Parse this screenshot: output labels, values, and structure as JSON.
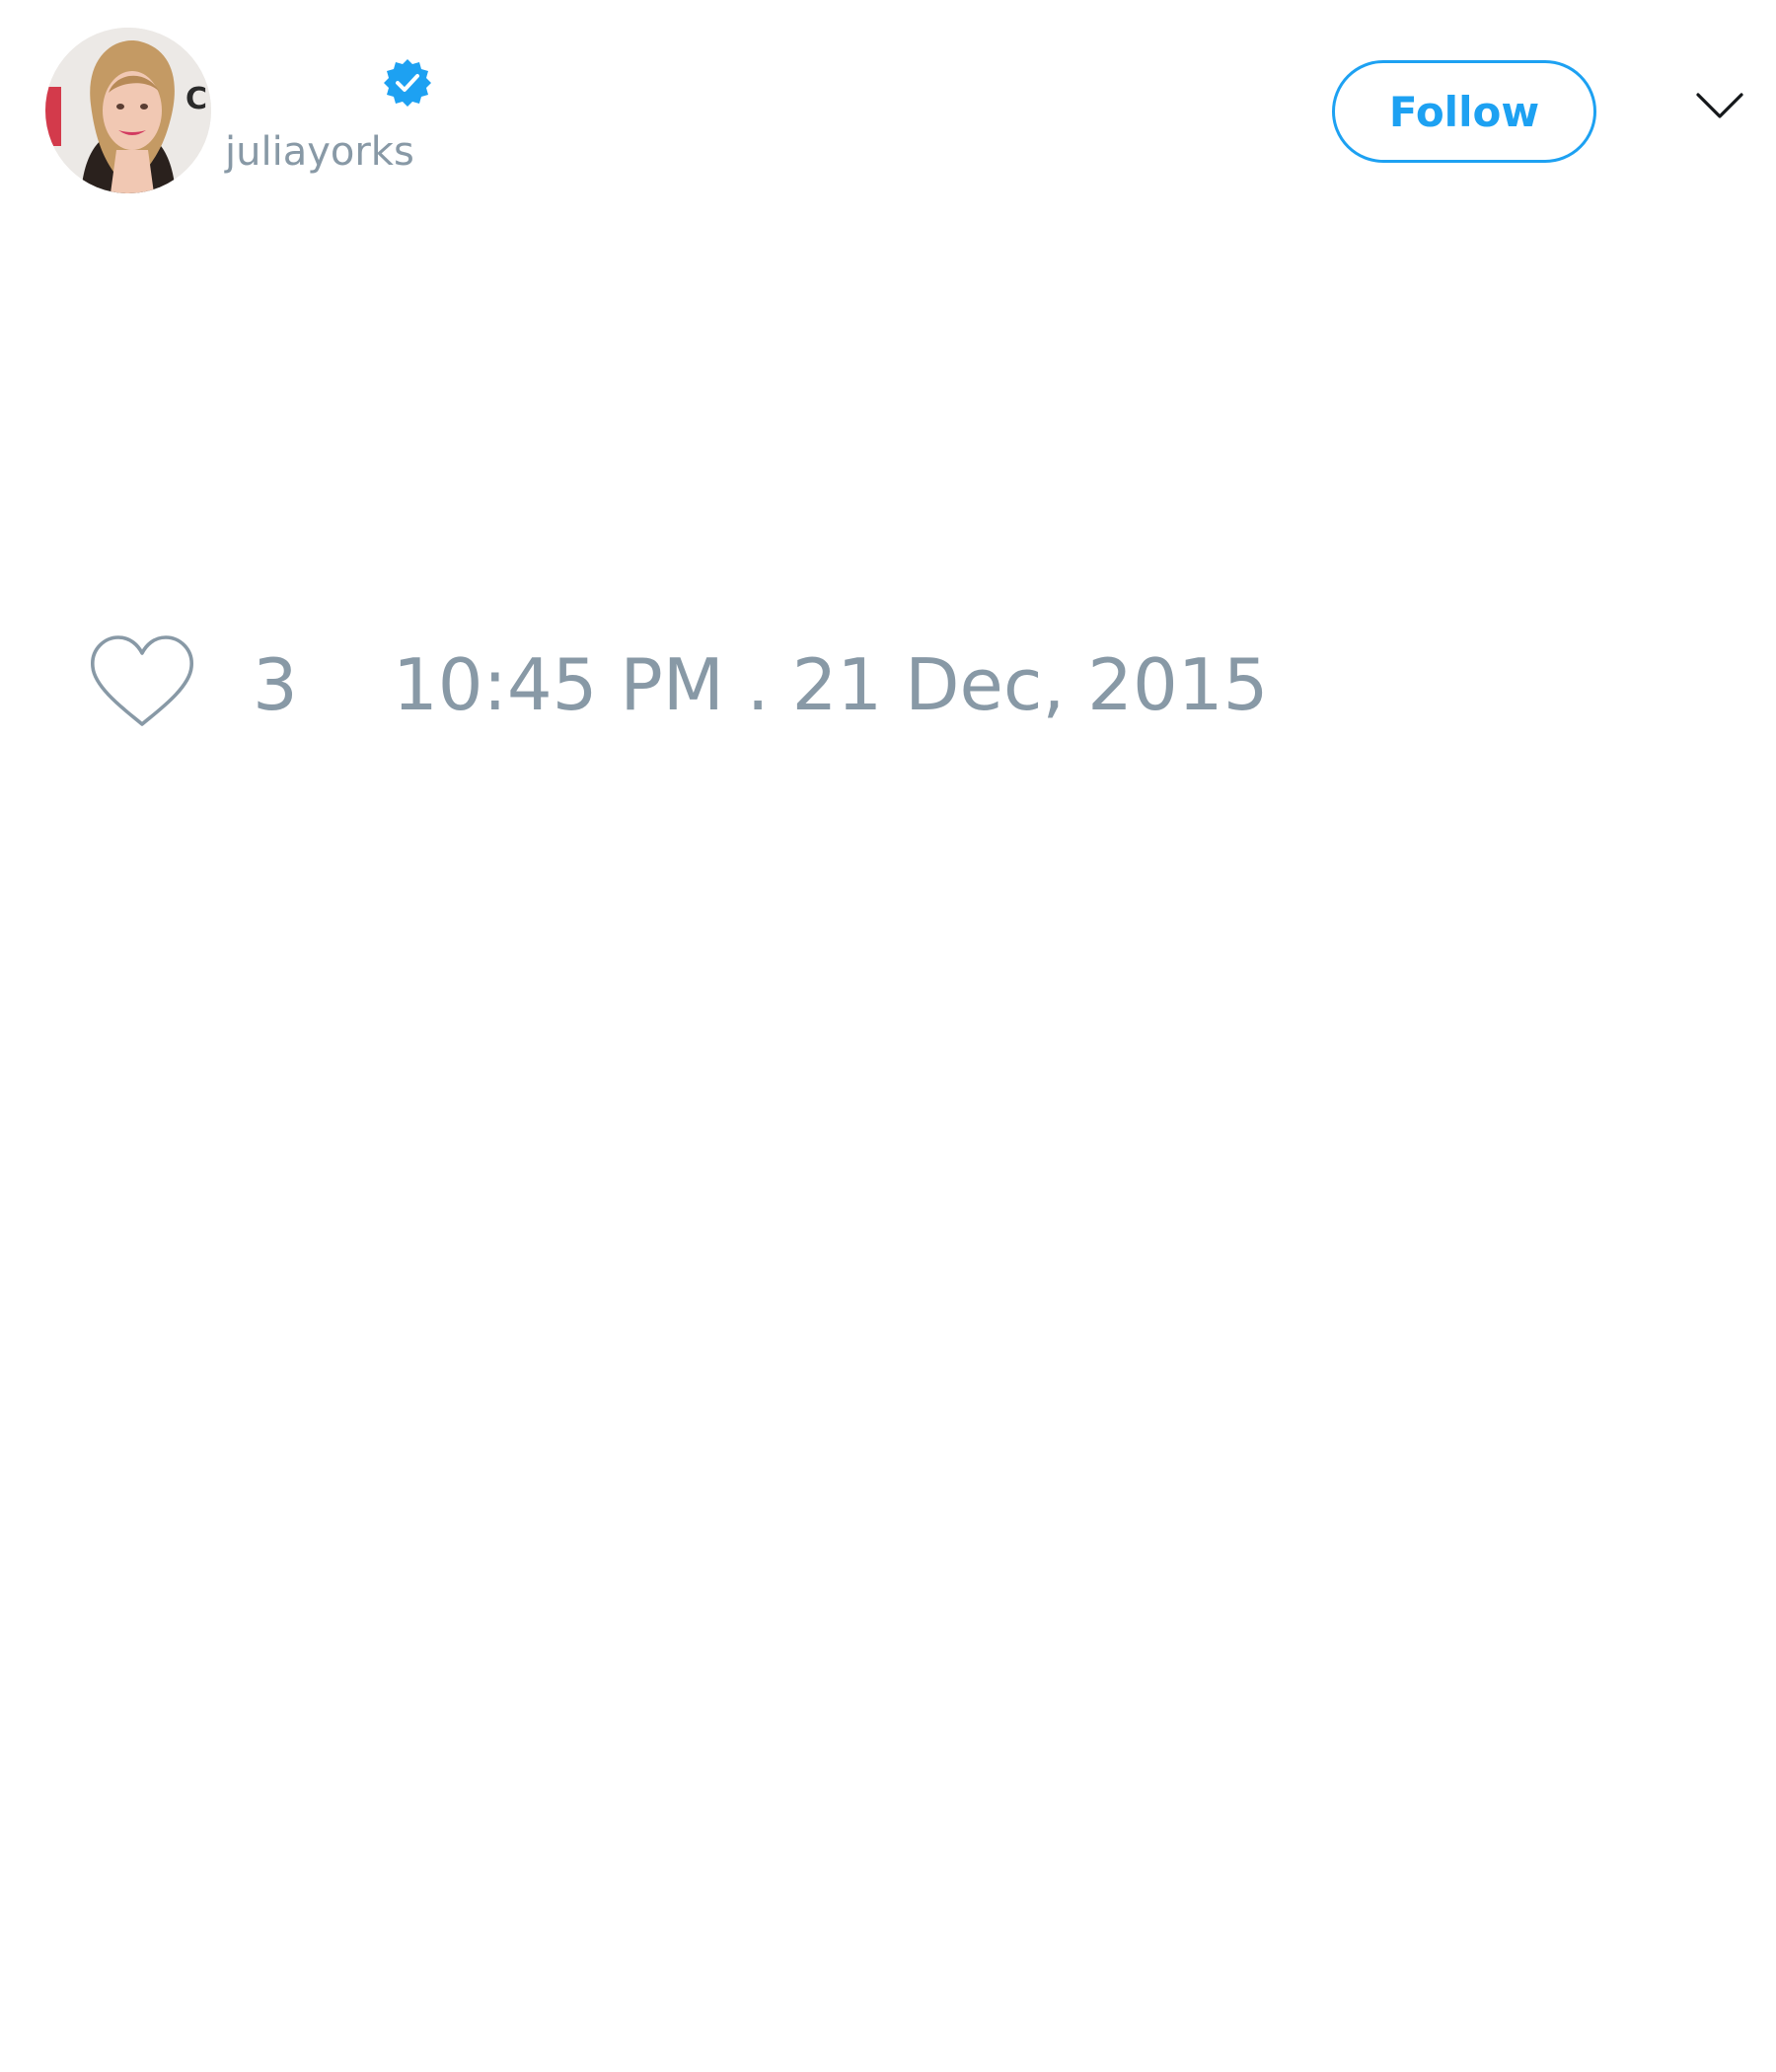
{
  "tweet": {
    "author": {
      "avatar_icon": "profile-photo",
      "verified_icon": "verified-badge-icon",
      "handle": "juliayorks"
    },
    "follow_label": "Follow",
    "menu_icon": "chevron-down-icon",
    "like_icon": "heart-icon",
    "like_count": "3",
    "timestamp": "10:45 PM . 21 Dec, 2015"
  },
  "colors": {
    "accent": "#1da1f2",
    "muted_text": "#8899a6",
    "background": "#ffffff"
  }
}
